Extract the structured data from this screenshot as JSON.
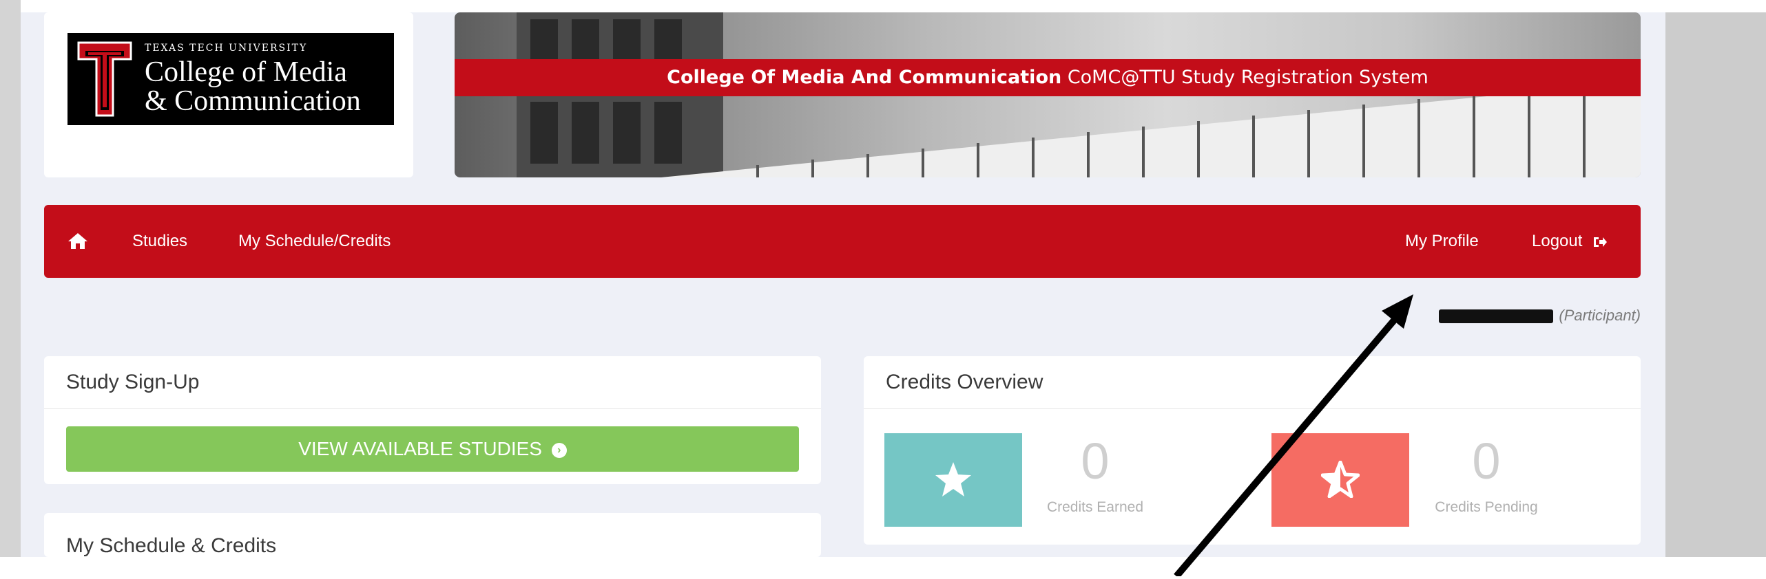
{
  "logo": {
    "university": "TEXAS TECH UNIVERSITY",
    "line1": "College of Media",
    "line2": "& Communication"
  },
  "banner": {
    "title_bold": "College Of Media And Communication",
    "title_rest": "CoMC@TTU Study Registration System"
  },
  "nav": {
    "home_icon": "home-icon",
    "studies": "Studies",
    "schedule": "My Schedule/Credits",
    "profile": "My Profile",
    "logout": "Logout",
    "logout_icon": "sign-out-icon"
  },
  "user": {
    "role": "(Participant)"
  },
  "signup": {
    "title": "Study Sign-Up",
    "button": "VIEW AVAILABLE STUDIES"
  },
  "schedule": {
    "title": "My Schedule & Credits"
  },
  "credits": {
    "title": "Credits Overview",
    "earned_value": "0",
    "earned_label": "Credits Earned",
    "pending_value": "0",
    "pending_label": "Credits Pending"
  },
  "colors": {
    "brand_red": "#c30d19",
    "button_green": "#85c75a",
    "tile_teal": "#75c6c5",
    "tile_coral": "#f56c63"
  }
}
